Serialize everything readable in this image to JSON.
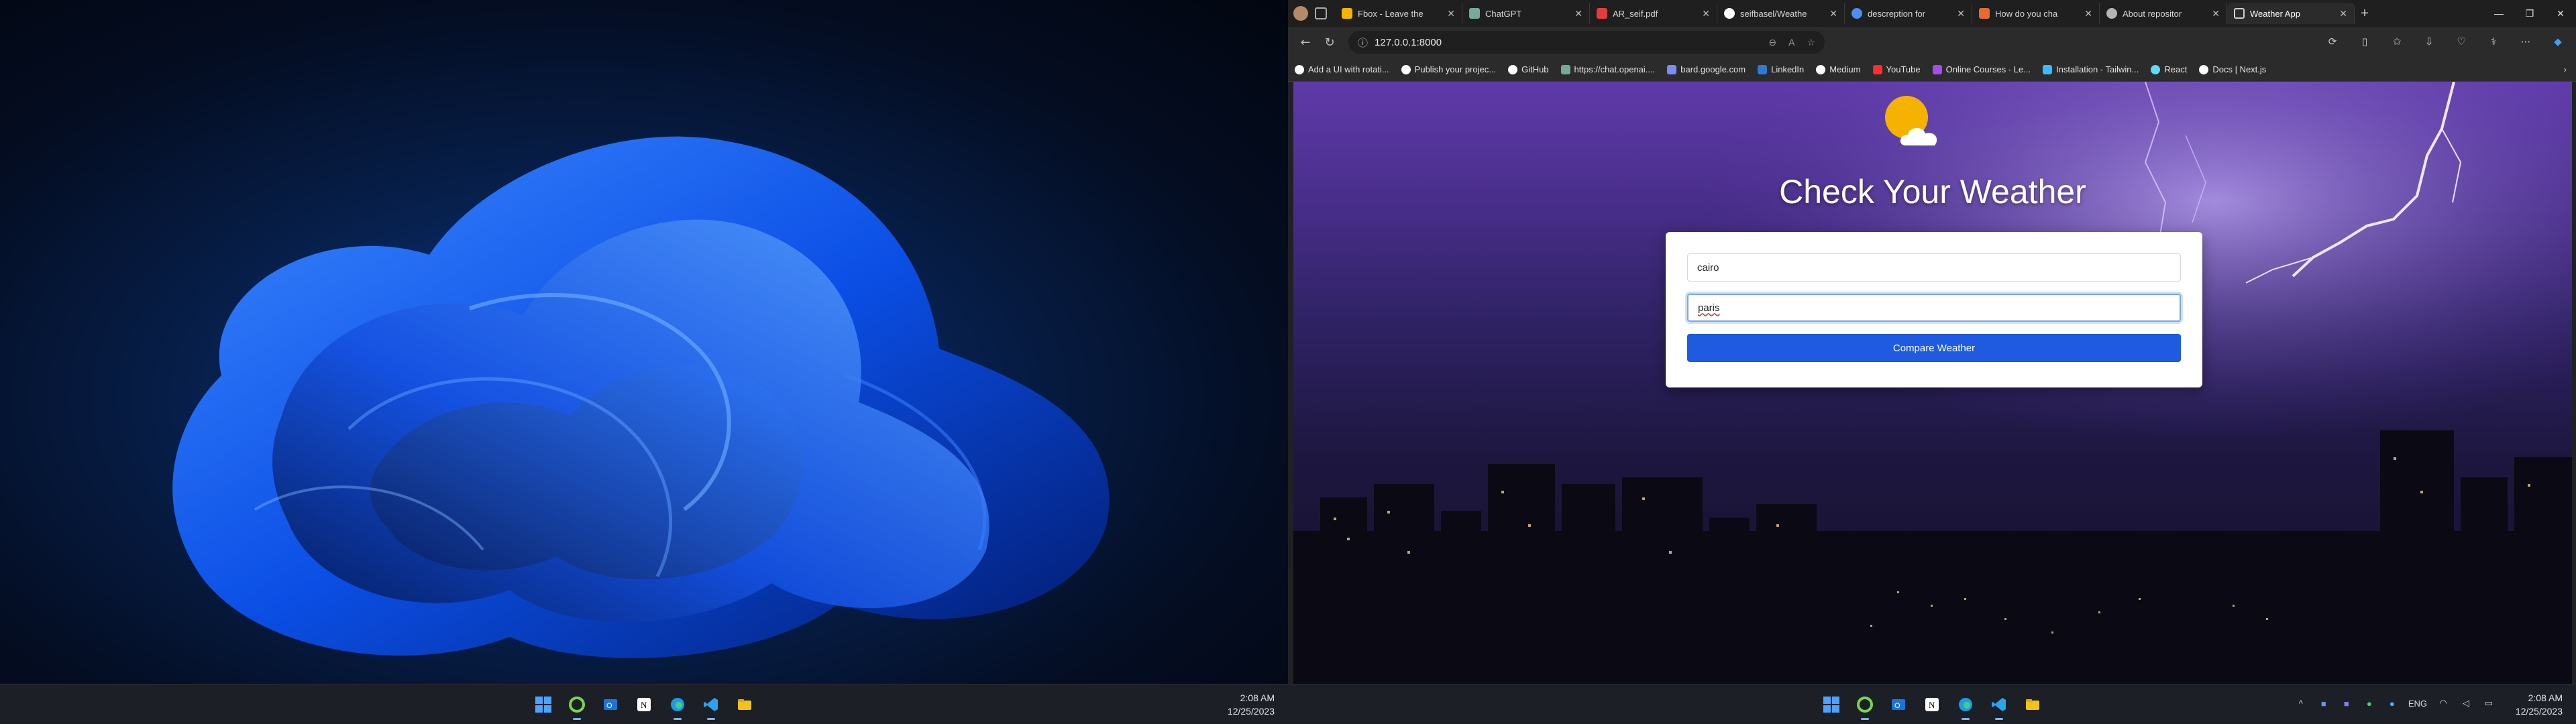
{
  "left_screen": {
    "taskbar": {
      "apps": [
        {
          "name": "start-button",
          "active": false
        },
        {
          "name": "spotify-like-app",
          "active": true
        },
        {
          "name": "outlook",
          "active": false
        },
        {
          "name": "notion",
          "active": false
        },
        {
          "name": "edge",
          "active": true
        },
        {
          "name": "vscode",
          "active": true
        },
        {
          "name": "file-explorer",
          "active": false
        }
      ],
      "time": "2:08 AM",
      "date": "12/25/2023"
    }
  },
  "browser": {
    "tabs": [
      {
        "label": "Fbox - Leave the",
        "icon_color": "#f5b400"
      },
      {
        "label": "ChatGPT",
        "icon_color": "#74aa9c"
      },
      {
        "label": "AR_seif.pdf",
        "icon_color": "#e23c3c"
      },
      {
        "label": "seifbasel/Weathe",
        "icon_color": "#ffffff"
      },
      {
        "label": "descreption for",
        "icon_color": "#4f8df5"
      },
      {
        "label": "How do you cha",
        "icon_color": "#e56b2f"
      },
      {
        "label": "About repositor",
        "icon_color": "#b5b5b5"
      },
      {
        "label": "Weather App",
        "icon_color": "#d0d0d0",
        "active": true
      }
    ],
    "address": "127.0.0.1:8000",
    "bookmarks": [
      {
        "label": "Add a UI with rotati...",
        "icon_color": "#ffffff"
      },
      {
        "label": "Publish your projec...",
        "icon_color": "#ffffff"
      },
      {
        "label": "GitHub",
        "icon_color": "#ffffff"
      },
      {
        "label": "https://chat.openai....",
        "icon_color": "#74aa9c"
      },
      {
        "label": "bard.google.com",
        "icon_color": "#7b8cf5"
      },
      {
        "label": "LinkedIn",
        "icon_color": "#2d7ad6"
      },
      {
        "label": "Medium",
        "icon_color": "#ffffff"
      },
      {
        "label": "YouTube",
        "icon_color": "#ff2d2d"
      },
      {
        "label": "Online Courses - Le...",
        "icon_color": "#a44cf2"
      },
      {
        "label": "Installation - Tailwin...",
        "icon_color": "#38bdf8"
      },
      {
        "label": "React",
        "icon_color": "#61dafb"
      },
      {
        "label": "Docs | Next.js",
        "icon_color": "#ffffff"
      }
    ],
    "page": {
      "title": "Check Your Weather",
      "city1_value": "cairo",
      "city2_value": "paris",
      "button_label": "Compare Weather"
    }
  },
  "right_screen": {
    "taskbar": {
      "tray_lang": "ENG",
      "time": "2:08 AM",
      "date": "12/25/2023"
    }
  }
}
